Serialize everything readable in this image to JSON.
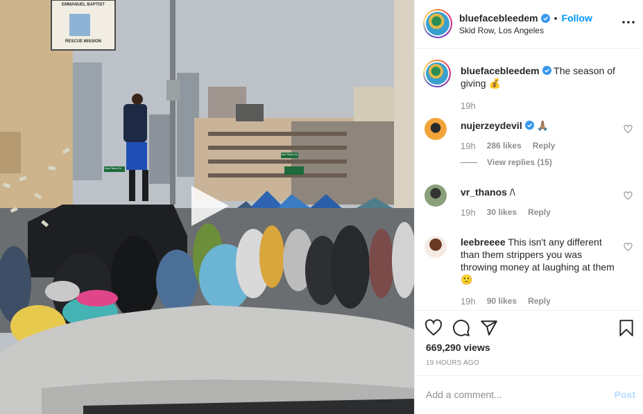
{
  "post": {
    "username": "bluefacebleedem",
    "verified": true,
    "follow_label": "Follow",
    "separator": "•",
    "location": "Skid Row, Los Angeles"
  },
  "media": {
    "sign_line1": "EMMANUEL BAPTIST",
    "sign_line2": "RESCUE MISSION",
    "street_sign1": "San Pedro St",
    "street_sign2": "San Pedro St"
  },
  "caption": {
    "username": "bluefacebleedem",
    "text": "The season of giving 💰",
    "time": "19h"
  },
  "comments": [
    {
      "username": "nujerzeydevil",
      "verified": true,
      "text": "🙏🏽",
      "time": "19h",
      "likes": "286 likes",
      "reply_label": "Reply",
      "view_replies": "View replies (15)"
    },
    {
      "username": "vr_thanos",
      "verified": false,
      "text": "/\\",
      "time": "19h",
      "likes": "30 likes",
      "reply_label": "Reply"
    },
    {
      "username": "leebreeee",
      "verified": false,
      "text": "This isn't any different than them strippers you was throwing money at laughing at them 🙁",
      "time": "19h",
      "likes": "90 likes",
      "reply_label": "Reply"
    }
  ],
  "stats": {
    "views": "669,290 views",
    "time_ago": "19 HOURS AGO"
  },
  "composer": {
    "placeholder": "Add a comment...",
    "post_label": "Post"
  },
  "colors": {
    "accent": "#0095f6",
    "muted": "#8e8e8e",
    "post_disabled": "#b3dbff"
  }
}
